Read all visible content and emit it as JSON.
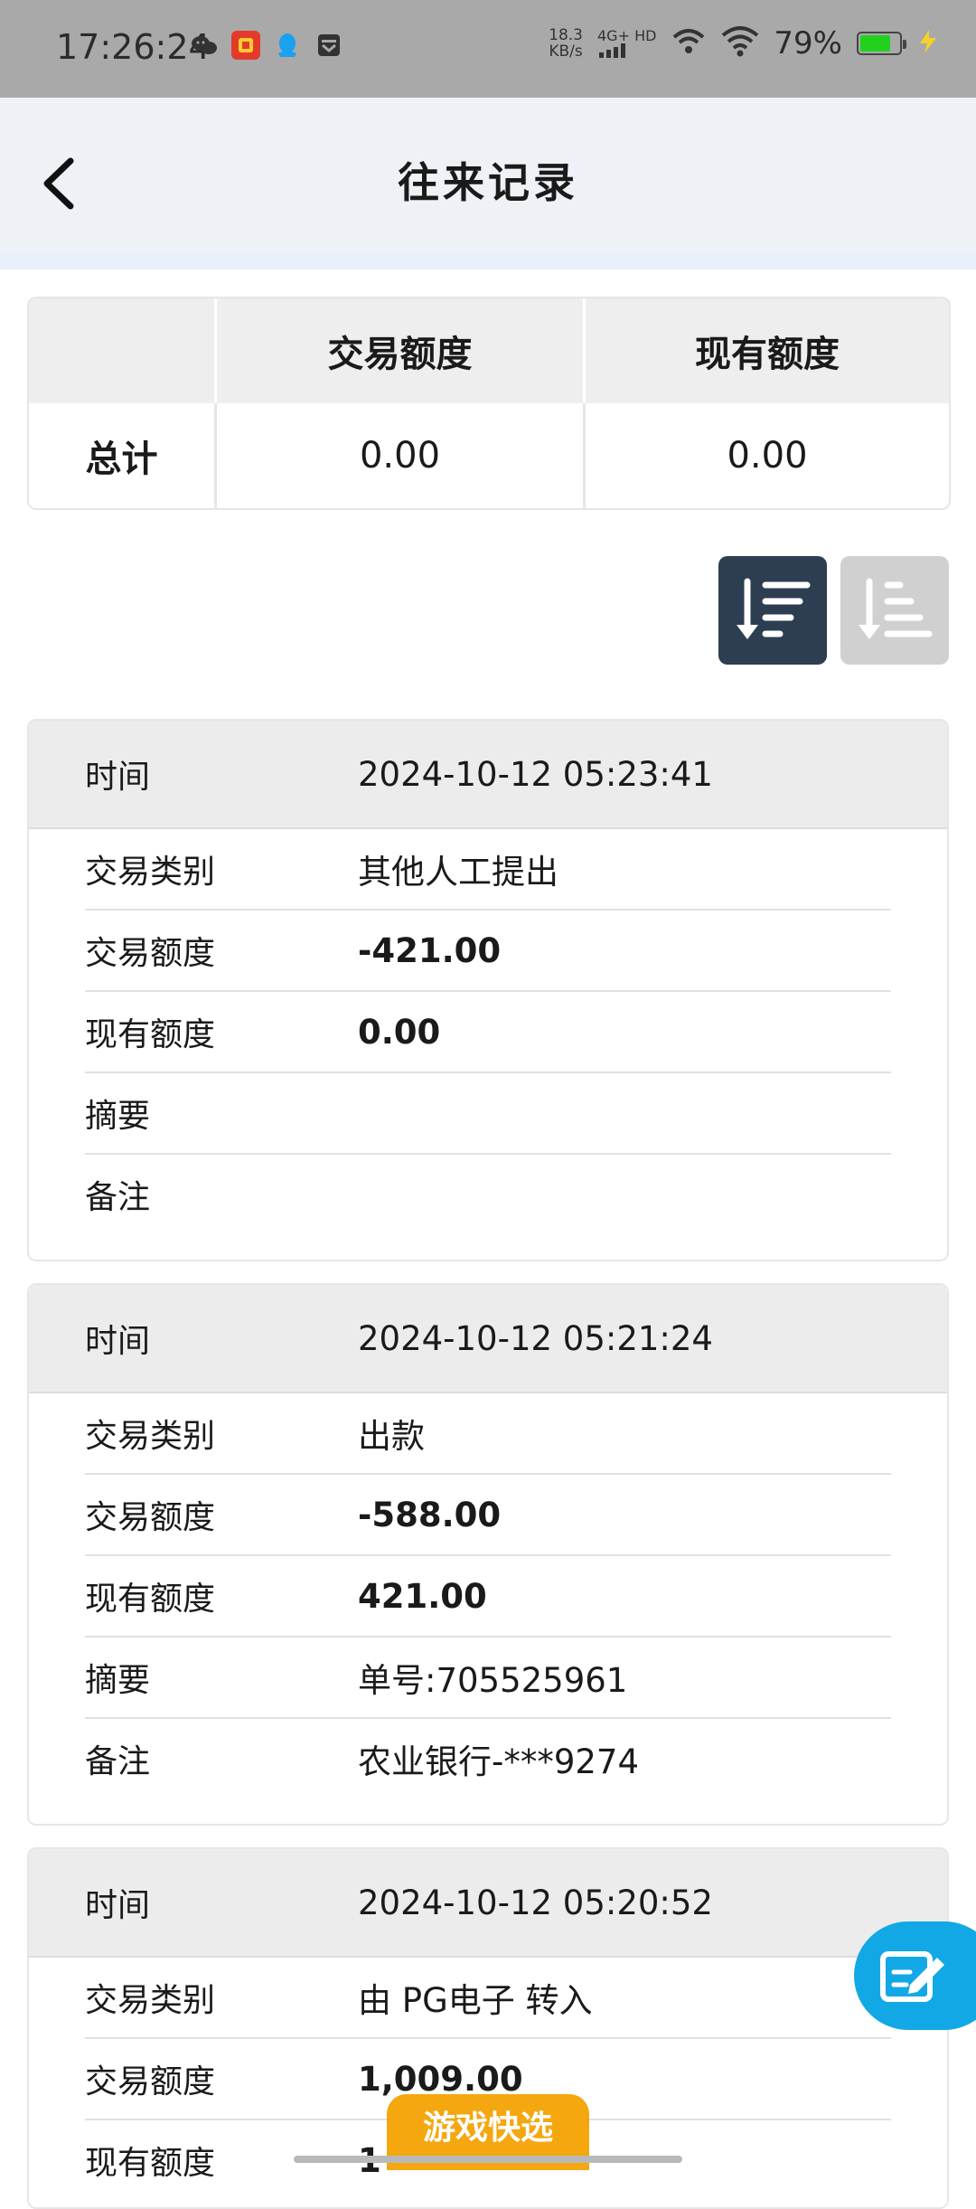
{
  "status_bar": {
    "time": "17:26:24",
    "net_speed_value": "18.3",
    "net_speed_unit": "KB/s",
    "network_type": "4G+ HD",
    "battery_percent": "79%",
    "battery_level": 0.79,
    "app_icons": [
      "wechat-icon",
      "taobao-icon",
      "qq-icon",
      "inbox-icon"
    ]
  },
  "header": {
    "title": "往来记录"
  },
  "summary": {
    "columns": [
      "交易额度",
      "现有额度"
    ],
    "row_label": "总计",
    "values": [
      "0.00",
      "0.00"
    ]
  },
  "sort": {
    "desc_active": true,
    "asc_active": false
  },
  "labels": {
    "time": "时间",
    "type": "交易类别",
    "amount": "交易额度",
    "balance": "现有额度",
    "summary": "摘要",
    "note": "备注"
  },
  "records": [
    {
      "time": "2024-10-12 05:23:41",
      "type": "其他人工提出",
      "amount": "-421.00",
      "balance": "0.00",
      "summary": "",
      "note": ""
    },
    {
      "time": "2024-10-12 05:21:24",
      "type": "出款",
      "amount": "-588.00",
      "balance": "421.00",
      "summary": "单号:705525961",
      "note": "农业银行-***9274"
    },
    {
      "time": "2024-10-12 05:20:52",
      "type": "由 PG电子 转入",
      "amount": "1,009.00",
      "balance": "1"
    }
  ],
  "game_button": "游戏快选",
  "colors": {
    "header_bg": "#eef1f6",
    "sort_active": "#2d3e52",
    "sort_inactive": "#d0d0d0",
    "fab": "#12a8e6",
    "game_button": "#f4a70f"
  }
}
